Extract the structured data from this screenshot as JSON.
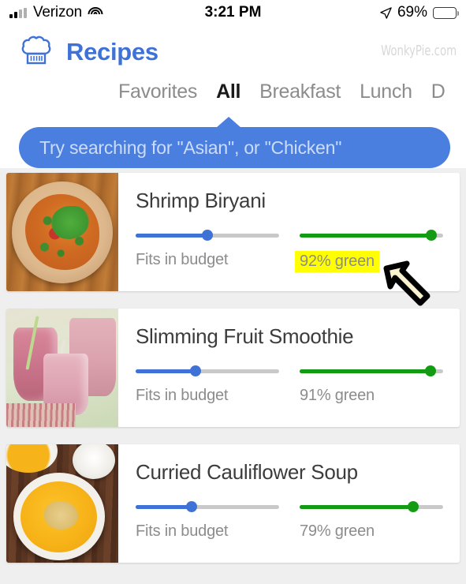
{
  "status_bar": {
    "carrier": "Verizon",
    "time": "3:21 PM",
    "battery_percent": "69%",
    "battery_level": 69,
    "signal_icon": "signal-bars-icon",
    "wifi_icon": "wifi-icon",
    "location_icon": "location-arrow-icon",
    "battery_icon": "battery-icon"
  },
  "header": {
    "logo_icon": "chef-hat-icon",
    "title": "Recipes",
    "watermark": "WonkyPie.com",
    "brand_color": "#3f72d7"
  },
  "tabs": [
    {
      "label": "Favorites",
      "active": false
    },
    {
      "label": "All",
      "active": true
    },
    {
      "label": "Breakfast",
      "active": false
    },
    {
      "label": "Lunch",
      "active": false
    },
    {
      "label": "D",
      "active": false
    }
  ],
  "search_tip": {
    "text": "Try searching for \"Asian\", or \"Chicken\"",
    "background_color": "#4a7fe0",
    "text_color": "#cddcf7"
  },
  "recipes": [
    {
      "name": "Shrimp Biryani",
      "budget_label": "Fits in budget",
      "budget_value": 50,
      "green_label": "92% green",
      "green_value": 92,
      "green_label_highlighted": true,
      "thumbnail": "shrimp-biryani-photo"
    },
    {
      "name": "Slimming Fruit Smoothie",
      "budget_label": "Fits in budget",
      "budget_value": 42,
      "green_label": "91% green",
      "green_value": 91,
      "green_label_highlighted": false,
      "thumbnail": "fruit-smoothie-photo"
    },
    {
      "name": "Curried Cauliflower Soup",
      "budget_label": "Fits in budget",
      "budget_value": 39,
      "green_label": "79% green",
      "green_value": 79,
      "green_label_highlighted": false,
      "thumbnail": "cauliflower-soup-photo"
    }
  ],
  "colors": {
    "budget_slider": "#3f72d7",
    "green_slider": "#149b14",
    "slider_track": "#c9c9c9",
    "highlight": "#ffff00",
    "page_background": "#efefef"
  },
  "cursor": {
    "icon": "mouse-pointer-arrow-icon"
  }
}
